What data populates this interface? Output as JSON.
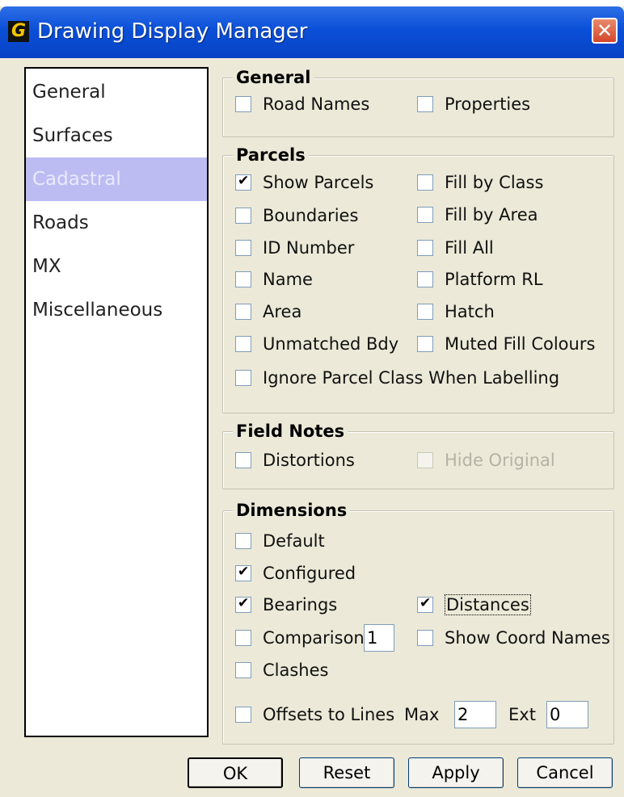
{
  "window": {
    "title": "Drawing Display Manager",
    "app_icon_letter": "G",
    "close_glyph": "✕"
  },
  "nav": {
    "items": [
      {
        "label": "General"
      },
      {
        "label": "Surfaces"
      },
      {
        "label": "Cadastral",
        "selected": true
      },
      {
        "label": "Roads"
      },
      {
        "label": "MX"
      },
      {
        "label": "Miscellaneous"
      }
    ]
  },
  "general": {
    "legend": "General",
    "road_names": {
      "label": "Road Names",
      "checked": false
    },
    "properties": {
      "label": "Properties",
      "checked": false
    }
  },
  "parcels": {
    "legend": "Parcels",
    "show_parcels": {
      "label": "Show Parcels",
      "checked": true
    },
    "fill_by_class": {
      "label": "Fill by Class",
      "checked": false
    },
    "boundaries": {
      "label": "Boundaries",
      "checked": false
    },
    "fill_by_area": {
      "label": "Fill by Area",
      "checked": false
    },
    "id_number": {
      "label": "ID Number",
      "checked": false
    },
    "fill_all": {
      "label": "Fill All",
      "checked": false
    },
    "name": {
      "label": "Name",
      "checked": false
    },
    "platform_rl": {
      "label": "Platform RL",
      "checked": false
    },
    "area": {
      "label": "Area",
      "checked": false
    },
    "hatch": {
      "label": "Hatch",
      "checked": false
    },
    "unmatched_bdy": {
      "label": "Unmatched Bdy",
      "checked": false
    },
    "muted_fill_colours": {
      "label": "Muted Fill Colours",
      "checked": false
    },
    "ignore_parcel_class": {
      "label": "Ignore Parcel Class When Labelling",
      "checked": false
    }
  },
  "field_notes": {
    "legend": "Field Notes",
    "distortions": {
      "label": "Distortions",
      "checked": false
    },
    "hide_original": {
      "label": "Hide Original",
      "checked": false,
      "disabled": true
    }
  },
  "dimensions": {
    "legend": "Dimensions",
    "default": {
      "label": "Default",
      "checked": false
    },
    "configured": {
      "label": "Configured",
      "checked": true
    },
    "bearings": {
      "label": "Bearings",
      "checked": true
    },
    "distances": {
      "label": "Distances",
      "checked": true
    },
    "comparisons": {
      "label": "Comparisons",
      "checked": false,
      "value": "1"
    },
    "show_coord_names": {
      "label": "Show Coord Names",
      "checked": false
    },
    "clashes": {
      "label": "Clashes",
      "checked": false
    },
    "offsets_to_lines": {
      "label": "Offsets to Lines",
      "checked": false
    },
    "max_label": "Max",
    "max_value": "2",
    "ext_label": "Ext",
    "ext_value": "0"
  },
  "buttons": {
    "ok": "OK",
    "reset": "Reset",
    "apply": "Apply",
    "cancel": "Cancel"
  }
}
